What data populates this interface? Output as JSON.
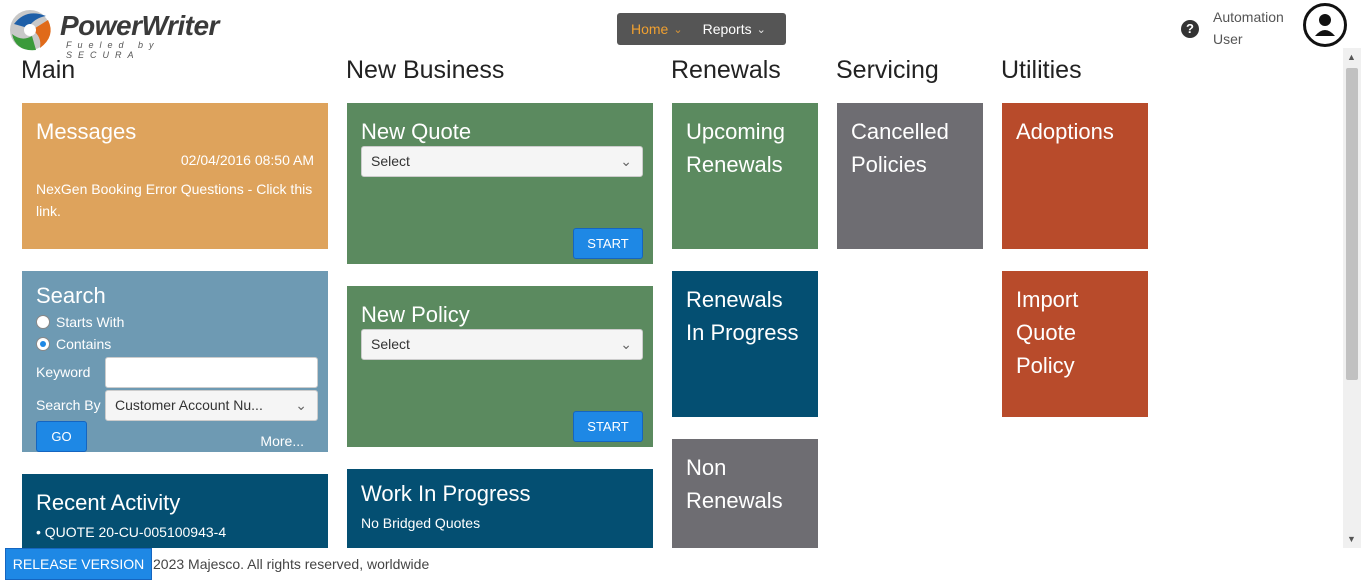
{
  "header": {
    "logo_text": "PowerWriter",
    "logo_sub": "Fueled by SECURA",
    "nav": [
      {
        "label": "Home",
        "active": true
      },
      {
        "label": "Reports",
        "active": false
      }
    ],
    "user": "Automation User"
  },
  "sections": {
    "main": "Main",
    "new_business": "New Business",
    "renewals": "Renewals",
    "servicing": "Servicing",
    "utilities": "Utilities"
  },
  "messages": {
    "title": "Messages",
    "date": "02/04/2016 08:50 AM",
    "text": "NexGen Booking Error Questions - Click this link."
  },
  "search": {
    "title": "Search",
    "starts_with": "Starts With",
    "contains": "Contains",
    "selected": "contains",
    "keyword_label": "Keyword",
    "keyword_value": "",
    "search_by_label": "Search By",
    "search_by_value": "Customer Account Nu...",
    "go": "GO",
    "more": "More..."
  },
  "recent_activity": {
    "title": "Recent Activity",
    "items": [
      "QUOTE 20-CU-005100943-4"
    ]
  },
  "new_quote": {
    "title": "New Quote",
    "select_value": "Select",
    "start": "START"
  },
  "new_policy": {
    "title": "New Policy",
    "select_value": "Select",
    "start": "START"
  },
  "work_in_progress": {
    "title": "Work In Progress",
    "text": "No Bridged Quotes"
  },
  "renewal_tiles": {
    "upcoming": "Upcoming Renewals",
    "in_progress": "Renewals In Progress",
    "non": "Non Renewals"
  },
  "servicing_tiles": {
    "cancelled": "Cancelled Policies"
  },
  "utilities_tiles": {
    "adoptions": "Adoptions",
    "import": "Import Quote Policy"
  },
  "footer": {
    "release_button": "RELEASE VERSION",
    "copyright": "2023 Majesco. All rights reserved, worldwide"
  },
  "colors": {
    "orange": "#dea35c",
    "green": "#5b8a5f",
    "teal": "#044f72",
    "gray": "#6e6d72",
    "rust": "#b84b2b",
    "slate": "#6e9ab3",
    "accent": "#1e88e5"
  }
}
